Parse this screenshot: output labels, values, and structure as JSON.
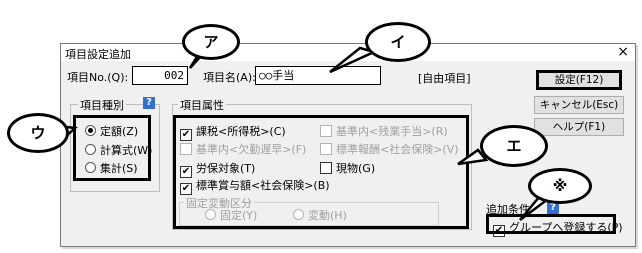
{
  "dialog": {
    "title": "項目設定追加",
    "close_glyph": "×"
  },
  "header": {
    "item_no_label": "項目No.(Q):",
    "item_no_value": "002",
    "item_name_label": "項目名(A):",
    "item_name_value": "○○手当",
    "free_item_label": "[自由項目]"
  },
  "buttons": {
    "ok": "設定(F12)",
    "cancel": "キャンセル(Esc)",
    "help": "ヘルプ(F1)"
  },
  "item_type": {
    "title": "項目種別",
    "help_glyph": "?",
    "options": [
      {
        "label": "定額(Z)",
        "selected": true
      },
      {
        "label": "計算式(W)",
        "selected": false
      },
      {
        "label": "集計(S)",
        "selected": false
      }
    ]
  },
  "item_attr": {
    "title": "項目属性",
    "checks": [
      {
        "label": "課税<所得税>(C)",
        "checked": true,
        "enabled": true
      },
      {
        "label": "基準内<欠勤遅早>(F)",
        "checked": false,
        "enabled": false
      },
      {
        "label": "労保対象(T)",
        "checked": true,
        "enabled": true
      },
      {
        "label": "標準賞与額<社会保険>(B)",
        "checked": true,
        "enabled": true
      },
      {
        "label": "基準内<残業手当>(R)",
        "checked": false,
        "enabled": false
      },
      {
        "label": "標準報酬<社会保険>(V)",
        "checked": false,
        "enabled": false
      },
      {
        "label": "現物(G)",
        "checked": false,
        "enabled": true
      }
    ],
    "fixed_variable": {
      "title": "固定変動区分",
      "options": [
        {
          "label": "固定(Y)"
        },
        {
          "label": "変動(H)"
        }
      ]
    }
  },
  "add_condition": {
    "title": "追加条件",
    "help_glyph": "?",
    "group_register": {
      "label": "グループへ登録する(P)",
      "checked": true
    }
  },
  "callouts": {
    "a": "ア",
    "i": "イ",
    "u": "ウ",
    "e": "エ",
    "note": "※"
  }
}
